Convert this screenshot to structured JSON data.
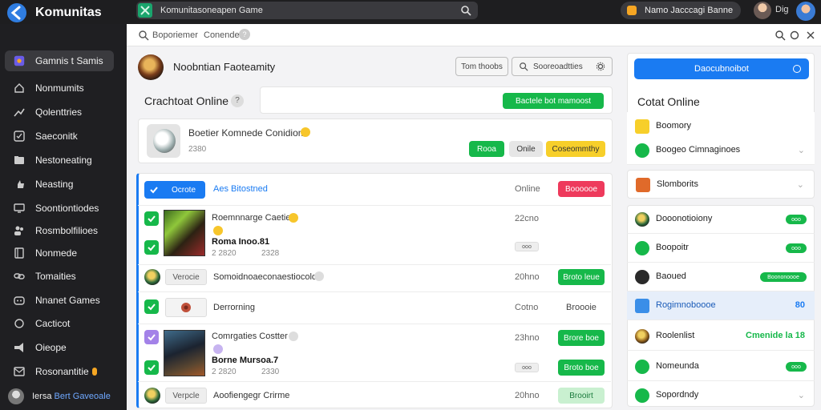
{
  "app": {
    "title": "Komunitas"
  },
  "search": {
    "text": "Komunitasoneapen Game"
  },
  "user": {
    "pill_text": "Namo Jacccagi Banne",
    "label": "Dig"
  },
  "sidebar": {
    "items": [
      {
        "label": "Gamnis t Samis",
        "icon": "game-icon"
      },
      {
        "label": "Nonmumits",
        "icon": "home-icon"
      },
      {
        "label": "Qolenttries",
        "icon": "trend-icon"
      },
      {
        "label": "Saeconitk",
        "icon": "check-square-icon"
      },
      {
        "label": "Nestoneating",
        "icon": "folder-icon"
      },
      {
        "label": "Neasting",
        "icon": "thumb-icon"
      },
      {
        "label": "Soontiontiodes",
        "icon": "monitor-icon"
      },
      {
        "label": "Rosmbolfilioes",
        "icon": "people-icon"
      },
      {
        "label": "Nonmede",
        "icon": "book-icon"
      },
      {
        "label": "Tomaities",
        "icon": "link-icon"
      },
      {
        "label": "Nnanet Games",
        "icon": "gamepad-icon"
      },
      {
        "label": "Cacticot",
        "icon": "circle-icon"
      },
      {
        "label": "Oieope",
        "icon": "megaphone-icon"
      },
      {
        "label": "Rosonantitie",
        "icon": "mail-icon"
      }
    ],
    "user": {
      "name": "Iersa",
      "highlight": "Bert Gaveoale"
    }
  },
  "subbar": {
    "text_a": "Boporiemer",
    "text_b": "Conende",
    "help": "?"
  },
  "community": {
    "name": "Noobntian Faoteamity",
    "btn_a": "Tom thoobs",
    "btn_b": "Sooreoadtties"
  },
  "chat_section": {
    "title": "Crachtoat Online",
    "help": "?",
    "green_button": "Bactele bot mamoost"
  },
  "post": {
    "title": "Boetier Komnede Conidiom",
    "sub": "2380",
    "btn_green": "Rooa",
    "btn_gray": "Onile",
    "btn_yellow": "Coseommthy"
  },
  "list": {
    "header": {
      "tab": "Ocrote",
      "title": "Aes Bitostned",
      "status": "Online",
      "badge": "Boooooe"
    },
    "rows": [
      {
        "title": "Roemnnarge Caetiee",
        "line2": "Roma Inoo.81",
        "meta": "2 2820",
        "meta2": "2328",
        "time": "22cno",
        "tag": "ooo"
      },
      {
        "tag": "Verocie",
        "title": "Somoidnoaeconaestiocolot",
        "time": "20hno",
        "button": "Broto leue"
      },
      {
        "title": "Derrorning",
        "time": "Cotno",
        "status": "Broooie"
      },
      {
        "title": "Comrgaties Costter",
        "line2": "Borne Mursoa.7",
        "meta": "2 2820",
        "meta2": "2330",
        "time": "23hno",
        "btn_a": "Brore boe",
        "btn_b": "Broto boe",
        "tag": "ooo"
      },
      {
        "tag": "Verpcle",
        "title": "Aoofiengegr Crirme",
        "time": "20hno",
        "button": "Brooirt"
      }
    ]
  },
  "right_panel": {
    "top_button": "Daocubnoibot",
    "online_title": "Cotat Online",
    "items": [
      {
        "label": "Boomory"
      },
      {
        "label": "Boogeo Cimnaginoes"
      },
      {
        "label": "Slomborits"
      },
      {
        "label": "Dooonotioiony",
        "pill": "ooo"
      },
      {
        "label": "Boopoitr",
        "pill": "ooo"
      },
      {
        "label": "Baoued",
        "pill": "Boononoooe"
      },
      {
        "label": "Rogimnoboooe",
        "badge": "80"
      },
      {
        "label": "Roolenlist",
        "badge": "Cmenide la 18"
      },
      {
        "label": "Nomeunda",
        "pill": "ooo"
      },
      {
        "label": "Sopordndy"
      }
    ]
  }
}
